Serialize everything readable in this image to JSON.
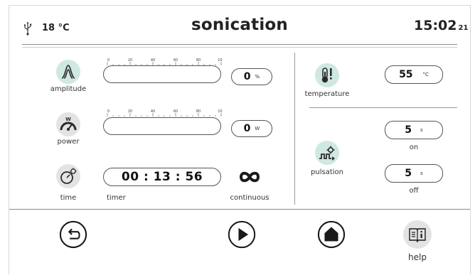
{
  "header": {
    "usb_icon": "usb-icon",
    "temperature": "18 °C",
    "title": "sonication",
    "time_main": "15:02",
    "time_seconds": "21"
  },
  "amplitude": {
    "label": "amplitude",
    "icon": "amplitude-icon",
    "scale": [
      "0",
      "20",
      "40",
      "60",
      "80",
      "100"
    ],
    "value": "0",
    "unit": "%",
    "level": 0
  },
  "power": {
    "label": "power",
    "icon": "power-gauge-icon",
    "icon_letter": "W",
    "scale": [
      "0",
      "20",
      "40",
      "60",
      "80",
      "100"
    ],
    "value": "0",
    "unit": "W",
    "level": 0
  },
  "time": {
    "label": "time",
    "icon": "stopwatch-icon",
    "timer_value": "00 : 13 : 56",
    "timer_label": "timer",
    "continuous_label": "continuous",
    "continuous_icon": "infinity-icon"
  },
  "temperature": {
    "label": "temperature",
    "icon": "thermometer-alert-icon",
    "value": "55",
    "unit": "°C"
  },
  "pulsation": {
    "label": "pulsation",
    "icon": "pulsation-icon",
    "on_value": "5",
    "on_unit": "s",
    "on_label": "on",
    "off_value": "5",
    "off_unit": "s",
    "off_label": "off"
  },
  "footer": {
    "back_icon": "back-icon",
    "play_icon": "play-icon",
    "home_icon": "home-icon",
    "help_icon": "help-book-icon",
    "help_label": "help"
  },
  "colors": {
    "teal_circle": "#cfe8e2",
    "grey_circle": "#e3e3e3",
    "icon_dark": "#2b2b2b"
  }
}
